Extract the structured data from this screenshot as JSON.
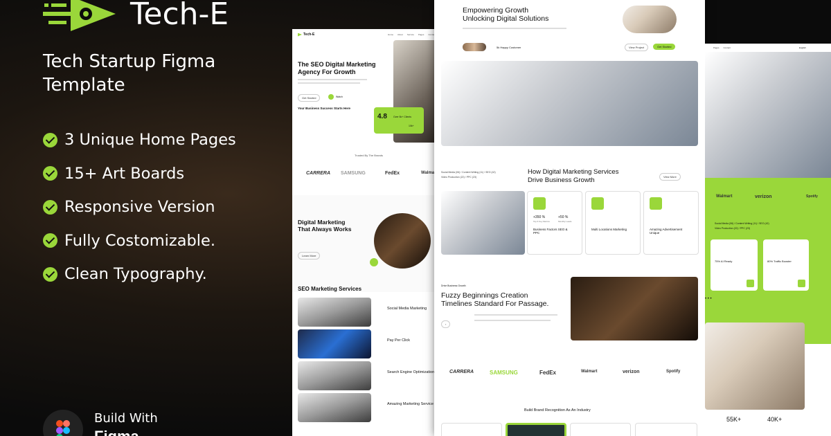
{
  "brand": {
    "name": "Tech-E",
    "tagline": "Tech Startup Figma Template"
  },
  "features": [
    "3 Unique Home Pages",
    "15+ Art Boards",
    "Responsive Version",
    "Fully Costomizable.",
    "Clean Typography."
  ],
  "footer": {
    "build_with": "Build With",
    "tool": "Figma"
  },
  "left_mock": {
    "logo": "Tech-E",
    "nav": [
      "Home",
      "About",
      "Service",
      "Pages",
      "Contact"
    ],
    "hero_title_1": "The SEO Digital Marketing",
    "hero_title_2": "Agency For Growth",
    "hero_btn": "Get Started",
    "watch": "Watch",
    "success": "Your Business Success Starts Here",
    "rating": "4.8",
    "clients": "Over 5k+ Clients",
    "plus": "10k+",
    "trusted": "Trusted By The Brands",
    "brands": [
      "CARRERA",
      "SAMSUNG",
      "FedEx",
      "Walmart"
    ],
    "dm_title_1": "Digital Marketing",
    "dm_title_2": "That Always Works",
    "learn": "Learn More",
    "seo_title": "SEO Marketing  Services",
    "services": [
      "Social Media Marketing",
      "Pay Per Click",
      "Search Engine Optimization",
      "Amazing Marketing Service"
    ]
  },
  "center_mock": {
    "hero_1": "Empowering Growth",
    "hero_2": "Unlocking Digital Solutions",
    "happy": "5k Happy Customer",
    "btn_outline": "View Project",
    "btn_green": "Get Started",
    "tags_1": "Social Media (06)  /  Content Writing (11)  /  SEO (42)",
    "tags_2": "Video Production (22)  /  PPC (23)",
    "svc_title_1": "How Digital Marketing Services",
    "svc_title_2": "Drive Business Growth",
    "view_more": "View More",
    "cards": [
      {
        "stat1": "+350 %",
        "stat2": "+50 %",
        "sub1": "Top 6 Key Metrics",
        "sub2": "Monthly Leads",
        "title": "Business Factors SEO & PPC"
      },
      {
        "title": "Multi Locations Marketing"
      },
      {
        "title": "Amazing Advertisement Unique"
      }
    ],
    "drive": "Drive Business Growth",
    "fuzzy_1": "Fuzzy Beginnings Creation",
    "fuzzy_2": "Timelines Standard For Passage.",
    "brands": [
      "CARRERA",
      "SAMSUNG",
      "FedEx",
      "Walmart",
      "verizon",
      "Spotify"
    ],
    "build_brand": "Build Brand Recognition As An Industry"
  },
  "right_mock": {
    "nav": [
      "Pages",
      "Contact"
    ],
    "lang": "English",
    "brands": [
      "Walmart",
      "verizon",
      "Spotify"
    ],
    "tags_1": "Social Media (06)  /  Content Writing (11)  /  SEO (42)",
    "tags_2": "Video Production (22)  /  PPC (23)",
    "card1": "75% AI Ready",
    "card2": "80% Traffic Booster",
    "stat1": "55K+",
    "stat2": "40K+"
  },
  "colors": {
    "accent": "#9ad73a",
    "dark": "#0c0c0c"
  }
}
